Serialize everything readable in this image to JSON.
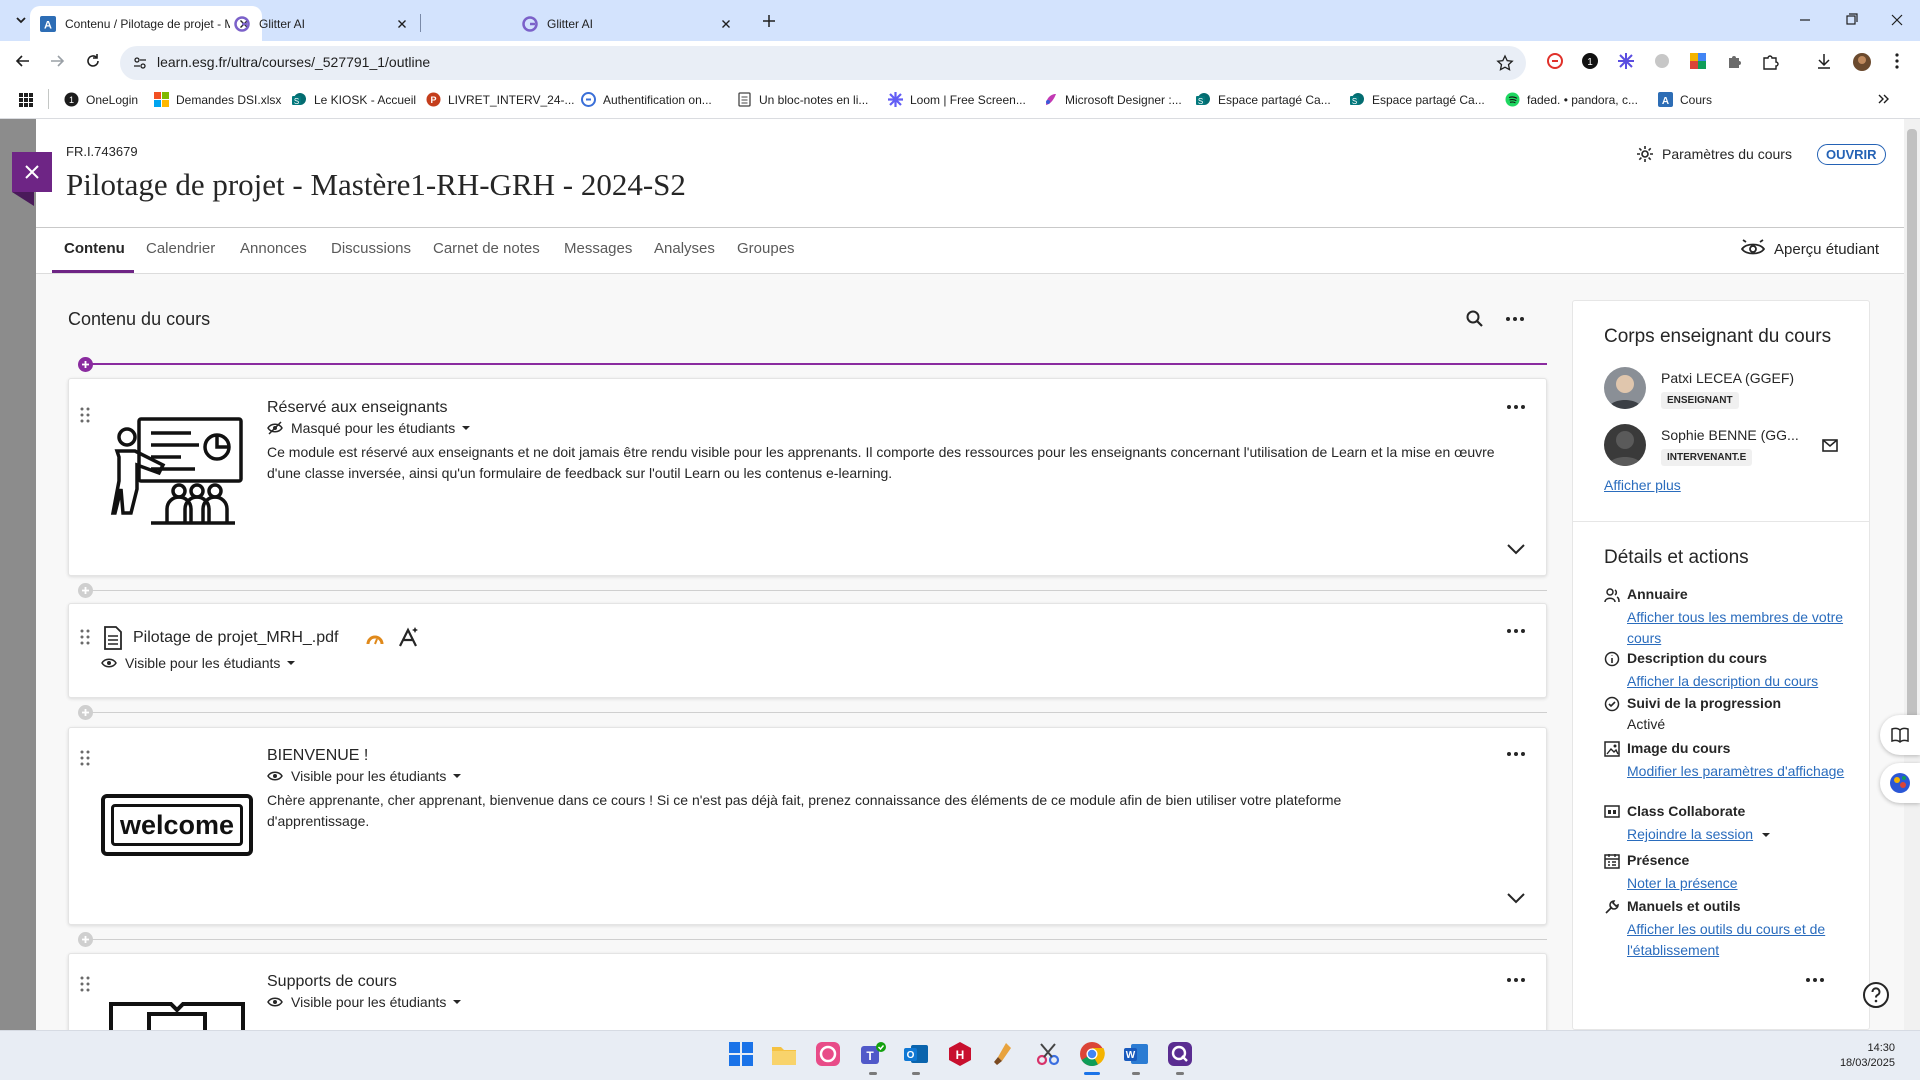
{
  "browser": {
    "tabs": [
      {
        "title": "Contenu / Pilotage de projet - M",
        "active": true
      },
      {
        "title": "Glitter AI",
        "active": false
      },
      {
        "title": "Glitter AI",
        "active": false
      }
    ],
    "url": "learn.esg.fr/ultra/courses/_527791_1/outline",
    "bookmarks": [
      {
        "label": "OneLogin",
        "icon": "onelogin-icon"
      },
      {
        "label": "Demandes DSI.xlsx",
        "icon": "microsoft-icon"
      },
      {
        "label": "Le KIOSK - Accueil",
        "icon": "sharepoint-icon"
      },
      {
        "label": "LIVRET_INTERV_24-...",
        "icon": "powerpoint-icon"
      },
      {
        "label": "Authentification on...",
        "icon": "auth-icon"
      },
      {
        "label": "Un bloc-notes en li...",
        "icon": "notepad-icon"
      },
      {
        "label": "Loom | Free Screen...",
        "icon": "loom-icon"
      },
      {
        "label": "Microsoft Designer :...",
        "icon": "designer-icon"
      },
      {
        "label": "Espace partagé Ca...",
        "icon": "sharepoint-icon"
      },
      {
        "label": "Espace partagé Ca...",
        "icon": "sharepoint-icon"
      },
      {
        "label": "faded. • pandora, c...",
        "icon": "spotify-icon"
      },
      {
        "label": "Cours",
        "icon": "blackboard-icon"
      }
    ]
  },
  "course": {
    "id": "FR.I.743679",
    "title": "Pilotage de projet - Mastère1-RH-GRH - 2024-S2",
    "params_label": "Paramètres du cours",
    "status": "OUVRIR",
    "student_preview": "Aperçu étudiant"
  },
  "nav_tabs": [
    "Contenu",
    "Calendrier",
    "Annonces",
    "Discussions",
    "Carnet de notes",
    "Messages",
    "Analyses",
    "Groupes"
  ],
  "content": {
    "heading": "Contenu du cours",
    "items": [
      {
        "title": "Réservé aux enseignants",
        "visibility": "Masqué pour les étudiants",
        "description": "Ce module est réservé aux enseignants et ne doit jamais être rendu visible pour les apprenants. Il comporte des ressources pour les enseignants concernant l'utilisation de Learn et la mise en œuvre d'une classe inversée, ainsi qu'un formulaire de feedback sur l'outil Learn ou les contenus e-learning."
      },
      {
        "title": "Pilotage de projet_MRH_.pdf",
        "visibility": "Visible pour les étudiants"
      },
      {
        "title": "BIENVENUE !",
        "visibility": "Visible pour les étudiants",
        "description": "Chère apprenante, cher apprenant, bienvenue dans ce cours ! Si ce n'est pas déjà fait, prenez connaissance des éléments de ce module afin de bien utiliser votre plateforme d'apprentissage.",
        "image_text": "welcome"
      },
      {
        "title": "Supports de cours",
        "visibility": "Visible pour les étudiants"
      }
    ]
  },
  "sidebar": {
    "faculty_heading": "Corps enseignant du cours",
    "faculty": [
      {
        "name": "Patxi LECEA (GGEF)",
        "role": "ENSEIGNANT"
      },
      {
        "name": "Sophie BENNE (GG...",
        "role": "INTERVENANT.E"
      }
    ],
    "show_more": "Afficher plus",
    "details_heading": "Détails et actions",
    "details": [
      {
        "title": "Annuaire",
        "link": "Afficher tous les membres de votre cours",
        "icon": "people-icon"
      },
      {
        "title": "Description du cours",
        "link": "Afficher la description du cours",
        "icon": "info-icon"
      },
      {
        "title": "Suivi de la progression",
        "value": "Activé",
        "icon": "progress-check-icon"
      },
      {
        "title": "Image du cours",
        "link": "Modifier les paramètres d'affichage",
        "icon": "image-icon"
      },
      {
        "title": "Class Collaborate",
        "link": "Rejoindre la session",
        "icon": "collaborate-icon"
      },
      {
        "title": "Présence",
        "link": "Noter la présence",
        "icon": "attendance-icon"
      },
      {
        "title": "Manuels et outils",
        "link": "Afficher les outils du cours et de l'établissement",
        "icon": "wrench-icon"
      }
    ]
  },
  "taskbar": {
    "time": "14:30",
    "date": "18/03/2025"
  },
  "colors": {
    "brand_purple": "#6e2585",
    "link_blue": "#2a6cbd",
    "tabbar_blue": "#d3e3fd"
  }
}
